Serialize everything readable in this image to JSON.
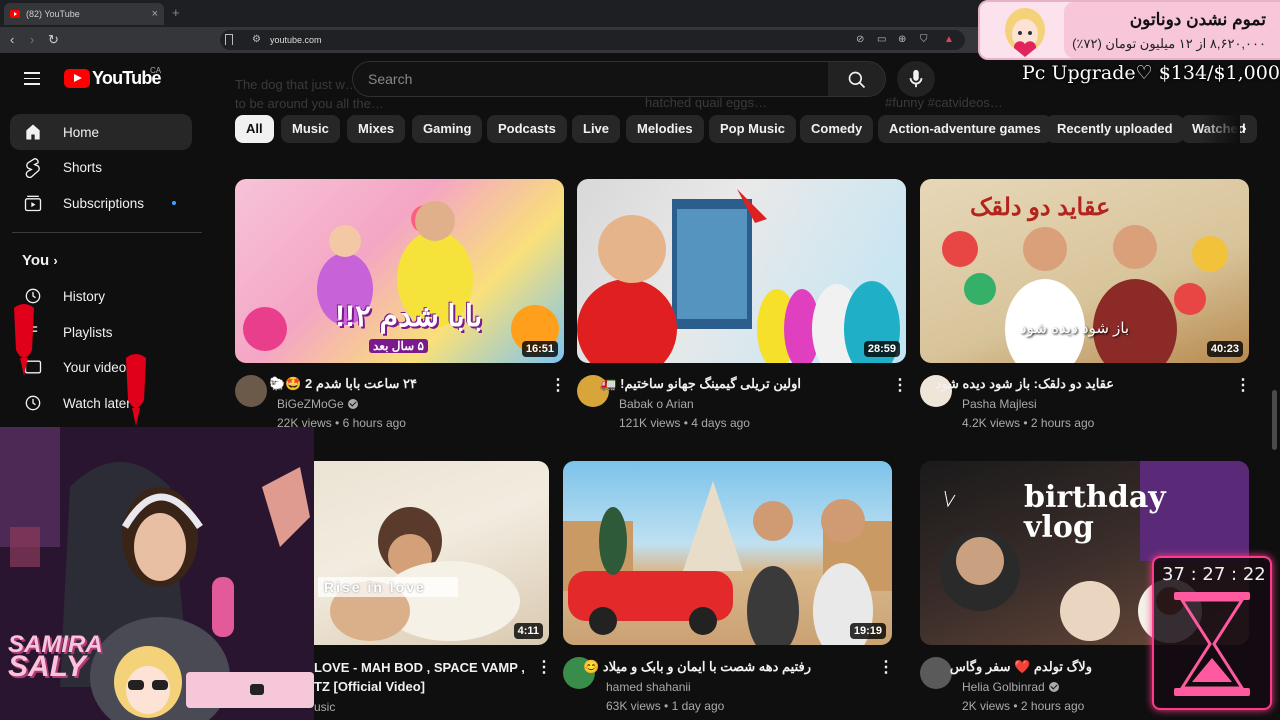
{
  "browser": {
    "tab_title": "(82) YouTube",
    "tab_close": "×",
    "new_tab": "+",
    "url": "youtube.com"
  },
  "masthead": {
    "logo_text": "YouTube",
    "region": "CA",
    "search_placeholder": "Search"
  },
  "sidebar": {
    "items": [
      {
        "label": "Home",
        "icon": "home-icon"
      },
      {
        "label": "Shorts",
        "icon": "shorts-icon"
      },
      {
        "label": "Subscriptions",
        "icon": "subscriptions-icon"
      }
    ],
    "you_label": "You",
    "you_items": [
      {
        "label": "History",
        "icon": "history-icon"
      },
      {
        "label": "Playlists",
        "icon": "playlists-icon"
      },
      {
        "label": "Your videos",
        "icon": "your-videos-icon"
      },
      {
        "label": "Watch later",
        "icon": "watch-later-icon"
      }
    ]
  },
  "chips": [
    "All",
    "Music",
    "Mixes",
    "Gaming",
    "Podcasts",
    "Live",
    "Melodies",
    "Pop Music",
    "Comedy",
    "Action-adventure games",
    "Recently uploaded",
    "Watched"
  ],
  "ghost_text": {
    "a": "The dog that just w…",
    "b": "to be around you all the…",
    "c": "hatched quail eggs…",
    "d": "#funny #catvideos…"
  },
  "videos": [
    {
      "title": "۲۴ ساعت بابا شدم 2 🤩🐑",
      "channel": "BiGeZMoGe",
      "verified": true,
      "views": "22K views",
      "age": "6 hours ago",
      "duration": "16:51",
      "thumb_text": "بابا شدم ۲!!",
      "thumb_sub": "۵ سال بعد"
    },
    {
      "title": "اولین تریلی گیمینگ جهانو ساختیم! 🚛",
      "channel": "Babak o Arian",
      "verified": false,
      "views": "121K views",
      "age": "4 days ago",
      "duration": "28:59"
    },
    {
      "title": "عقاید دو دلقک: باز شود دیده شود",
      "channel": "Pasha Majlesi",
      "verified": false,
      "views": "4.2K views",
      "age": "2 hours ago",
      "duration": "40:23",
      "thumb_text": "عقاید دو دلقک",
      "thumb_sub": "باز شود دیده شود"
    },
    {
      "title": "LOVE - MAH BOD , SPACE VAMP ,",
      "title2": "TZ [Official Video]",
      "channel": "usic",
      "verified": false,
      "views": "",
      "age": "",
      "duration": "4:11",
      "thumb_text": "Rise in love"
    },
    {
      "title": "رفتیم دهه شصت با ایمان و بابک و میلاد 😊",
      "channel": "hamed shahanii",
      "verified": false,
      "views": "63K views",
      "age": "1 day ago",
      "duration": "19:19"
    },
    {
      "title": "ولاگ تولدم ❤️ سفر وگاس",
      "channel": "Helia Golbinrad",
      "verified": true,
      "views": "2K views",
      "age": "2 hours ago",
      "duration": "",
      "thumb_text": "birthday vlog"
    }
  ],
  "overlay": {
    "donation_line1": "تموم نشدن دوناتون",
    "donation_line2": "۸,۶۲۰,۰۰۰ از ۱۲ میلیون تومان (۷۲٪)",
    "upgrade": "Pc Upgrade♡ $134/$1,000",
    "streamer": "SAMIRA",
    "streamer2": "SALY",
    "timer": "37 : 27 : 22"
  },
  "colors": {
    "background": "#0f0f0f",
    "accent_red": "#ff0000",
    "chip_bg": "#272727",
    "overlay_pink": "#ff3a8c"
  }
}
